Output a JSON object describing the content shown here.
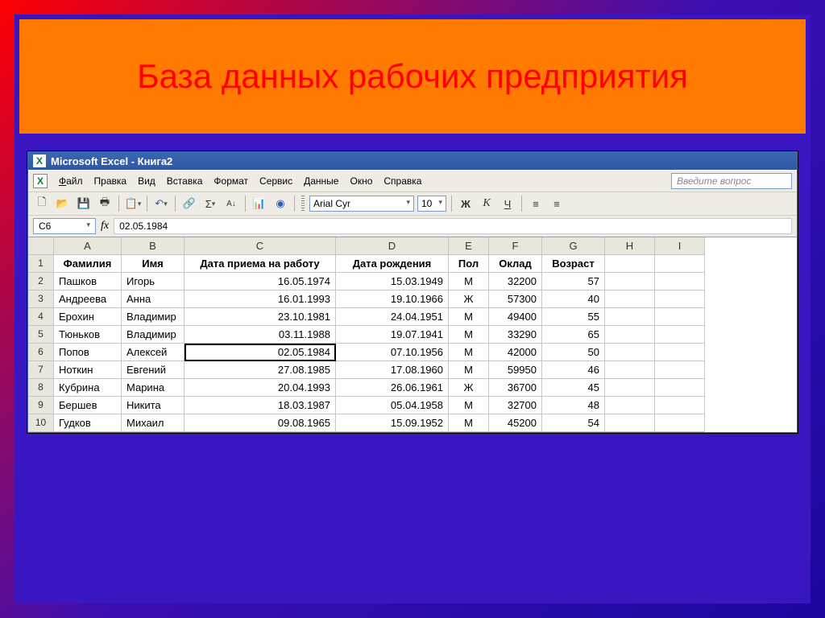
{
  "slide": {
    "title": "База данных рабочих предприятия"
  },
  "window": {
    "title": "Microsoft Excel - Книга2",
    "app_letter": "X"
  },
  "menu": {
    "file": "Файл",
    "edit": "Правка",
    "view": "Вид",
    "insert": "Вставка",
    "format": "Формат",
    "service": "Сервис",
    "data": "Данные",
    "window": "Окно",
    "help": "Справка",
    "ask_placeholder": "Введите вопрос"
  },
  "toolbar": {
    "font_name": "Arial Cyr",
    "font_size": "10",
    "bold": "Ж",
    "italic": "К",
    "underline": "Ч"
  },
  "formula_bar": {
    "name_box": "C6",
    "fx": "fx",
    "value": "02.05.1984"
  },
  "columns": [
    "A",
    "B",
    "C",
    "D",
    "E",
    "F",
    "G",
    "H",
    "I"
  ],
  "headers": [
    "Фамилия",
    "Имя",
    "Дата приема на работу",
    "Дата рождения",
    "Пол",
    "Оклад",
    "Возраст"
  ],
  "rows": [
    {
      "n": "2",
      "a": "Пашков",
      "b": "Игорь",
      "c": "16.05.1974",
      "d": "15.03.1949",
      "e": "М",
      "f": "32200",
      "g": "57"
    },
    {
      "n": "3",
      "a": "Андреева",
      "b": "Анна",
      "c": "16.01.1993",
      "d": "19.10.1966",
      "e": "Ж",
      "f": "57300",
      "g": "40"
    },
    {
      "n": "4",
      "a": "Ерохин",
      "b": "Владимир",
      "c": "23.10.1981",
      "d": "24.04.1951",
      "e": "М",
      "f": "49400",
      "g": "55"
    },
    {
      "n": "5",
      "a": "Тюньков",
      "b": "Владимир",
      "c": "03.11.1988",
      "d": "19.07.1941",
      "e": "М",
      "f": "33290",
      "g": "65"
    },
    {
      "n": "6",
      "a": "Попов",
      "b": "Алексей",
      "c": "02.05.1984",
      "d": "07.10.1956",
      "e": "М",
      "f": "42000",
      "g": "50"
    },
    {
      "n": "7",
      "a": "Ноткин",
      "b": "Евгений",
      "c": "27.08.1985",
      "d": "17.08.1960",
      "e": "М",
      "f": "59950",
      "g": "46"
    },
    {
      "n": "8",
      "a": "Кубрина",
      "b": "Марина",
      "c": "20.04.1993",
      "d": "26.06.1961",
      "e": "Ж",
      "f": "36700",
      "g": "45"
    },
    {
      "n": "9",
      "a": "Бершев",
      "b": "Никита",
      "c": "18.03.1987",
      "d": "05.04.1958",
      "e": "М",
      "f": "32700",
      "g": "48"
    },
    {
      "n": "10",
      "a": "Гудков",
      "b": "Михаил",
      "c": "09.08.1965",
      "d": "15.09.1952",
      "e": "М",
      "f": "45200",
      "g": "54"
    }
  ],
  "active_cell_row": "6"
}
